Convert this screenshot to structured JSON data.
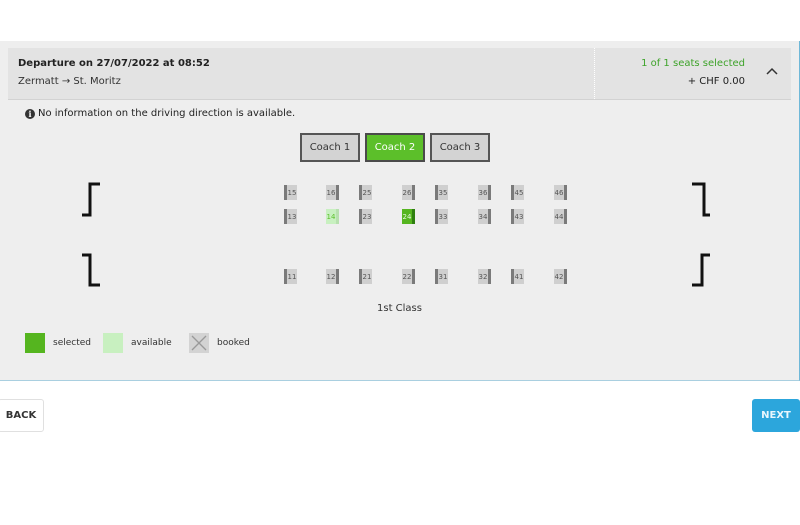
{
  "header": {
    "title": "Departure on 27/07/2022 at 08:52",
    "route": "Zermatt → St. Moritz",
    "seats_selected": "1 of 1 seats selected",
    "price": "+ CHF 0.00",
    "toggle_icon": "chevron-up-icon"
  },
  "info": {
    "icon": "info-icon",
    "icon_glyph": "i",
    "text": "No information on the driving direction is available."
  },
  "coaches": [
    {
      "label": "Coach 1",
      "active": false
    },
    {
      "label": "Coach 2",
      "active": true
    },
    {
      "label": "Coach 3",
      "active": false
    }
  ],
  "seats": {
    "row1": [
      "15",
      "16",
      "25",
      "26",
      "35",
      "36",
      "45",
      "46"
    ],
    "row2": [
      "13",
      "14",
      "23",
      "24",
      "33",
      "34",
      "43",
      "44"
    ],
    "row3": [
      "11",
      "12",
      "21",
      "22",
      "31",
      "32",
      "41",
      "42"
    ],
    "available": [
      "14"
    ],
    "selected": [
      "24"
    ]
  },
  "class_label": "1st Class",
  "legend": [
    {
      "label": "selected",
      "color": "#55b51f"
    },
    {
      "label": "available",
      "color": "#c8f0c0"
    },
    {
      "label": "booked",
      "color": "#d3d3d3"
    }
  ],
  "colors": {
    "accent_green": "#5cbf2a",
    "next_blue": "#2ca6dc"
  },
  "footer": {
    "back_label": "BACK",
    "next_label": "NEXT"
  }
}
